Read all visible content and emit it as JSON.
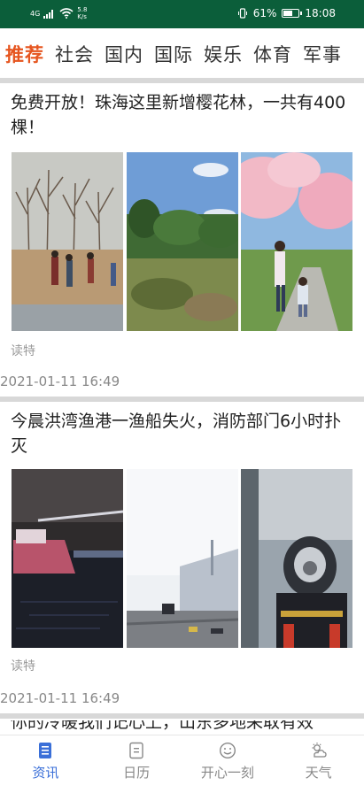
{
  "status_bar": {
    "network_label": "4G",
    "net_speed_value": "5.8",
    "net_speed_unit": "K/s",
    "battery": "61%",
    "battery_level": 0.61,
    "time": "18:08"
  },
  "tabs": [
    {
      "label": "推荐",
      "active": true
    },
    {
      "label": "社会",
      "active": false
    },
    {
      "label": "国内",
      "active": false
    },
    {
      "label": "国际",
      "active": false
    },
    {
      "label": "娱乐",
      "active": false
    },
    {
      "label": "体育",
      "active": false
    },
    {
      "label": "军事",
      "active": false
    }
  ],
  "articles": [
    {
      "title": "免费开放！珠海这里新增樱花林，一共有400棵！",
      "source": "读特",
      "time": "2021-01-11 16:49"
    },
    {
      "title": "今晨洪湾渔港一渔船失火，消防部门6小时扑灭",
      "source": "读特",
      "time": "2021-01-11 16:49"
    }
  ],
  "partial_title": "你的冷暖我们记心上，山东多地采取有效",
  "bottom_nav": [
    {
      "label": "资讯",
      "icon": "news-icon",
      "active": true
    },
    {
      "label": "日历",
      "icon": "calendar-icon",
      "active": false
    },
    {
      "label": "开心一刻",
      "icon": "smile-icon",
      "active": false
    },
    {
      "label": "天气",
      "icon": "weather-icon",
      "active": false
    }
  ],
  "colors": {
    "status_bar": "#0b5e3a",
    "active_tab": "#e6551f",
    "active_nav": "#3a6fd8"
  }
}
